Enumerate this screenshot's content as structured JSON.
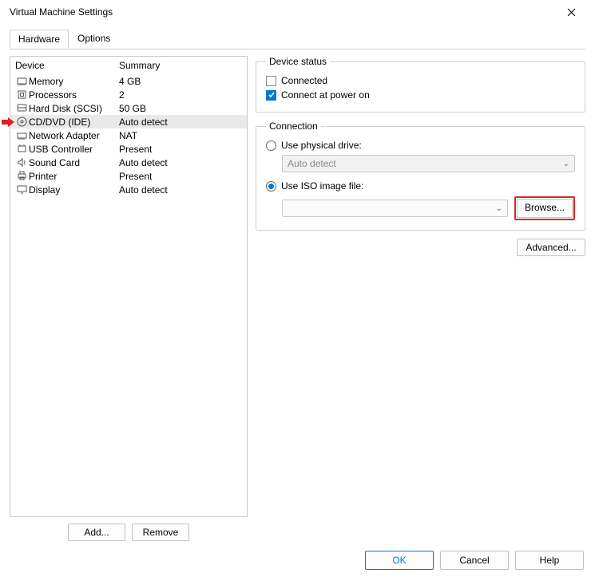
{
  "window": {
    "title": "Virtual Machine Settings"
  },
  "tabs": {
    "hardware": "Hardware",
    "options": "Options"
  },
  "headers": {
    "device": "Device",
    "summary": "Summary"
  },
  "devices": [
    {
      "icon": "memory",
      "name": "Memory",
      "summary": "4 GB"
    },
    {
      "icon": "cpu",
      "name": "Processors",
      "summary": "2"
    },
    {
      "icon": "hdd",
      "name": "Hard Disk (SCSI)",
      "summary": "50 GB"
    },
    {
      "icon": "disc",
      "name": "CD/DVD (IDE)",
      "summary": "Auto detect"
    },
    {
      "icon": "net",
      "name": "Network Adapter",
      "summary": "NAT"
    },
    {
      "icon": "usb",
      "name": "USB Controller",
      "summary": "Present"
    },
    {
      "icon": "sound",
      "name": "Sound Card",
      "summary": "Auto detect"
    },
    {
      "icon": "printer",
      "name": "Printer",
      "summary": "Present"
    },
    {
      "icon": "display",
      "name": "Display",
      "summary": "Auto detect"
    }
  ],
  "buttons": {
    "add": "Add...",
    "remove": "Remove",
    "browse": "Browse...",
    "advanced": "Advanced...",
    "ok": "OK",
    "cancel": "Cancel",
    "help": "Help"
  },
  "status": {
    "legend": "Device status",
    "connected": "Connected",
    "connect_power": "Connect at power on"
  },
  "connection": {
    "legend": "Connection",
    "use_physical": "Use physical drive:",
    "auto_detect": "Auto detect",
    "use_iso": "Use ISO image file:",
    "iso_value": ""
  }
}
